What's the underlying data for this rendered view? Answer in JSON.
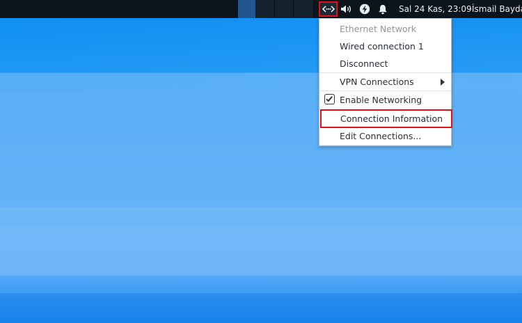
{
  "panel": {
    "clock": "Sal 24 Kas, 23:09",
    "user": "İsmail Bayda",
    "tray_icons": [
      "network-icon",
      "volume-icon",
      "power-icon",
      "bell-icon"
    ]
  },
  "menu": {
    "header": "Ethernet Network",
    "items": {
      "wired": "Wired connection 1",
      "disconnect": "Disconnect",
      "vpn": "VPN Connections",
      "enable": "Enable Networking",
      "conninfo": "Connection Information",
      "edit": "Edit Connections..."
    },
    "enable_checked": true
  },
  "colors": {
    "highlight": "#e3101a",
    "panel_bg": "#0c141c",
    "desktop_blue": "#1e98f4"
  }
}
